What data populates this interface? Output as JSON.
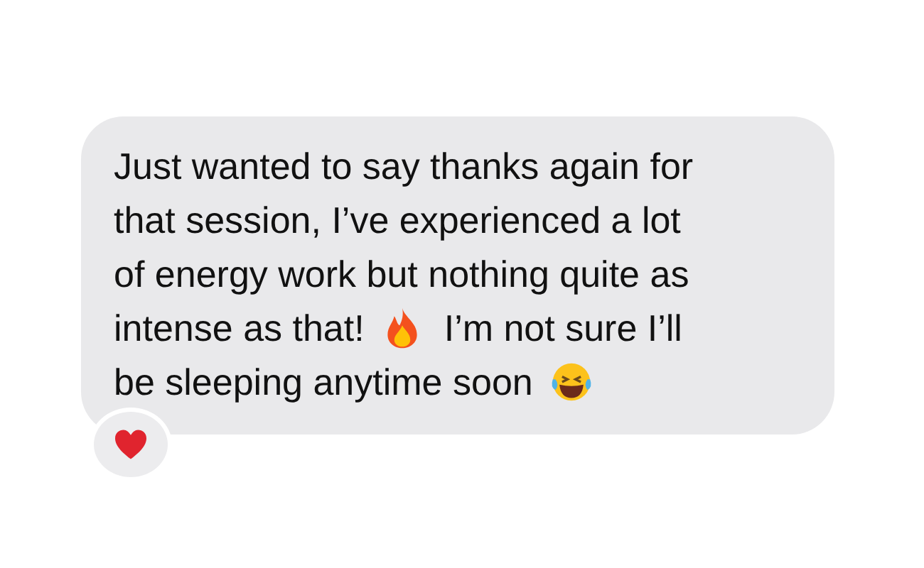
{
  "message": {
    "lines": [
      [
        {
          "kind": "text",
          "text": "Just wanted to say thanks again for"
        }
      ],
      [
        {
          "kind": "text",
          "text": "that session, I’ve experienced a lot"
        }
      ],
      [
        {
          "kind": "text",
          "text": "of energy work but nothing quite as"
        }
      ],
      [
        {
          "kind": "text",
          "text": "intense as that!"
        },
        {
          "kind": "fire"
        },
        {
          "kind": "text",
          "text": "I’m not sure I’ll"
        }
      ],
      [
        {
          "kind": "text",
          "text": "be sleeping anytime soon"
        },
        {
          "kind": "laughing"
        }
      ]
    ]
  }
}
